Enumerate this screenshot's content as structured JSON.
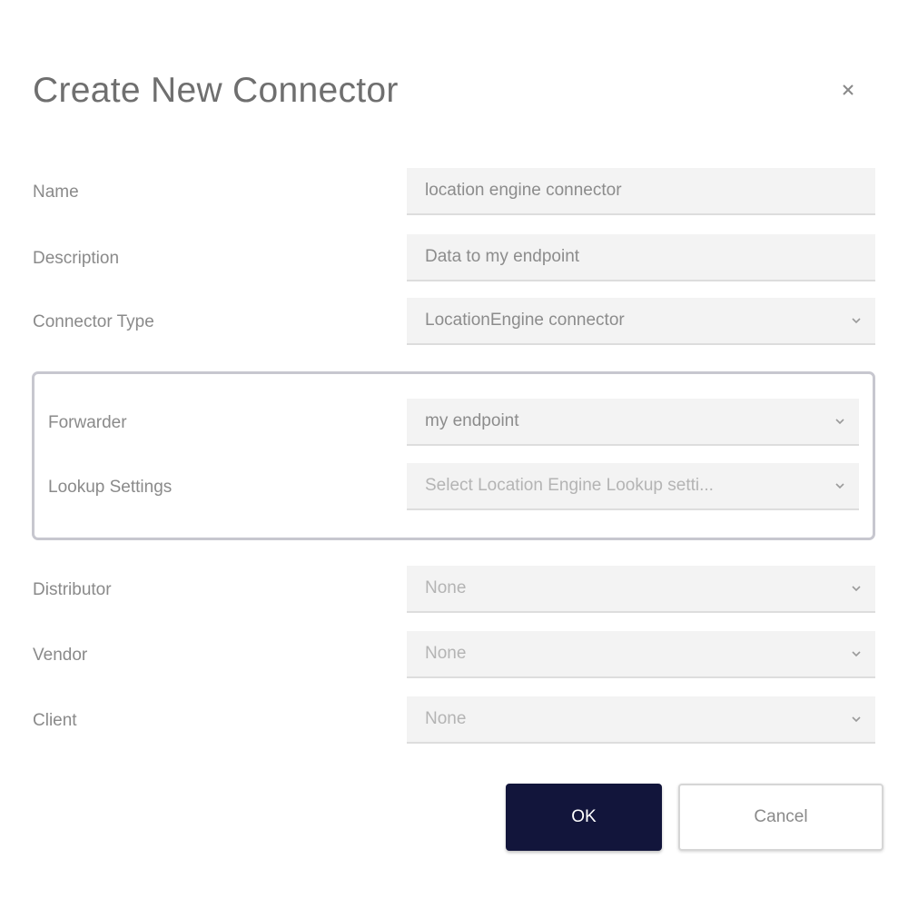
{
  "dialog": {
    "title": "Create New Connector",
    "close_icon": "close-icon"
  },
  "fields": {
    "name": {
      "label": "Name",
      "value": "location engine connector"
    },
    "description": {
      "label": "Description",
      "value": "Data to my endpoint"
    },
    "connector_type": {
      "label": "Connector Type",
      "value": "LocationEngine connector"
    },
    "forwarder": {
      "label": "Forwarder",
      "value": "my endpoint"
    },
    "lookup_settings": {
      "label": "Lookup Settings",
      "placeholder": "Select Location Engine Lookup setti..."
    },
    "distributor": {
      "label": "Distributor",
      "placeholder": "None"
    },
    "vendor": {
      "label": "Vendor",
      "placeholder": "None"
    },
    "client": {
      "label": "Client",
      "placeholder": "None"
    }
  },
  "buttons": {
    "ok_label": "OK",
    "cancel_label": "Cancel"
  },
  "colors": {
    "primary_button": "#12153b",
    "field_background": "#f3f3f3",
    "group_border": "#c7c7cf"
  },
  "icons": {
    "dropdown": "chevron-down-icon",
    "close": "close-icon"
  }
}
